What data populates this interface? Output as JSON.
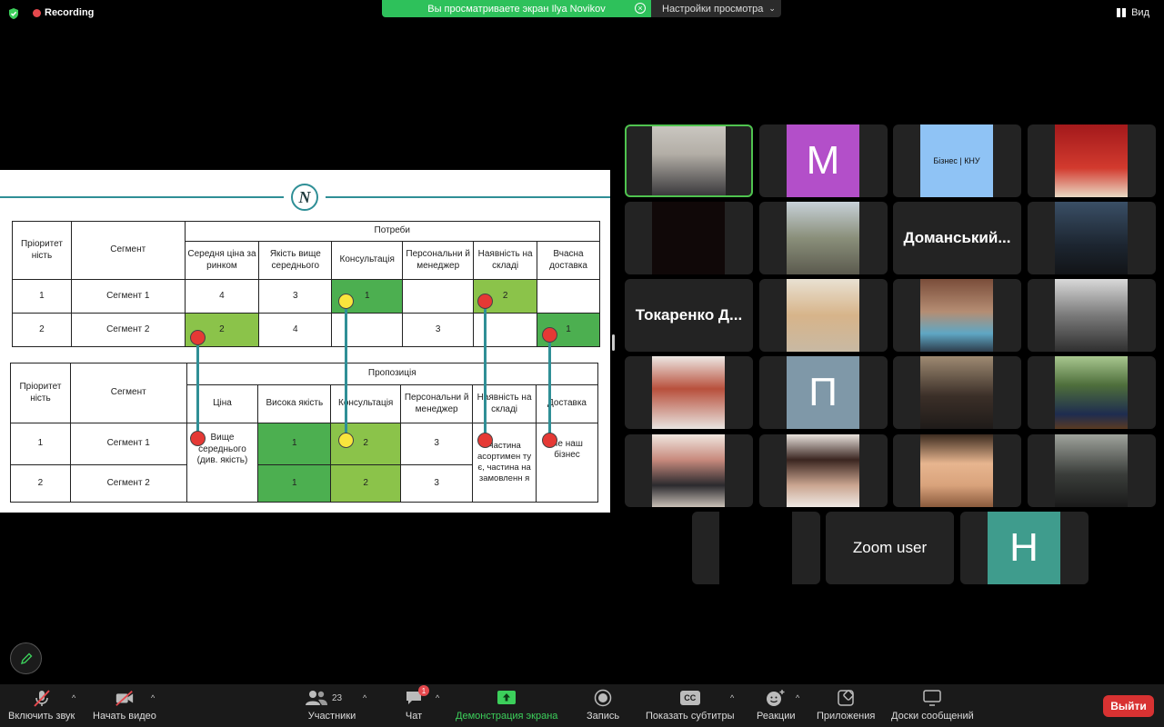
{
  "top": {
    "recording": "Recording",
    "banner": "Вы просматриваете экран Ilya Novikov",
    "view_settings": "Настройки просмотра",
    "view": "Вид"
  },
  "slide": {
    "table1": {
      "col1": "Пріоритет ність",
      "col2": "Сегмент",
      "group": "Потреби",
      "headers": [
        "Середня ціна за ринком",
        "Якість вище середнього",
        "Консультація",
        "Персональни й менеджер",
        "Наявність на складі",
        "Вчасна доставка"
      ],
      "rows": [
        {
          "p": "1",
          "s": "Сегмент 1",
          "cells": [
            "4",
            "3",
            "1",
            "",
            "2",
            ""
          ]
        },
        {
          "p": "2",
          "s": "Сегмент 2",
          "cells": [
            "2",
            "4",
            "",
            "3",
            "",
            "1"
          ]
        }
      ]
    },
    "table2": {
      "col1": "Пріоритет ність",
      "col2": "Сегмент",
      "group": "Пропозиція",
      "headers": [
        "Ціна",
        "Висока якість",
        "Консультація",
        "Персональни й менеджер",
        "Наявність на складі",
        "Доставка"
      ],
      "rows": [
        {
          "p": "1",
          "s": "Сегмент 1",
          "c1": "1",
          "c2": "2",
          "c3": "3"
        },
        {
          "p": "2",
          "s": "Сегмент 2",
          "c1": "1",
          "c2": "2",
          "c3": "3"
        }
      ],
      "price_note": "Вище середнього (див. якість)",
      "stock_note": "Частина асортимен ту є, частина на замовленн я",
      "delivery_note": "Не наш бізнес"
    }
  },
  "participants": {
    "m": "M",
    "biz": "Бізнес | КНУ",
    "domansky": "Доманський...",
    "tokarenko": "Токаренко Д...",
    "p": "П",
    "zoom_user": "Zoom user",
    "h": "H"
  },
  "toolbar": {
    "audio": "Включить звук",
    "video": "Начать видео",
    "participants": "Участники",
    "participants_count": "23",
    "chat": "Чат",
    "chat_badge": "1",
    "share": "Демонстрация экрана",
    "record": "Запись",
    "subtitles": "Показать субтитры",
    "reactions": "Реакции",
    "apps": "Приложения",
    "boards": "Доски сообщений",
    "leave": "Выйти"
  },
  "colors": {
    "accent_green": "#2ec15b",
    "leave_red": "#d83232",
    "slide_teal": "#2f8f96"
  }
}
